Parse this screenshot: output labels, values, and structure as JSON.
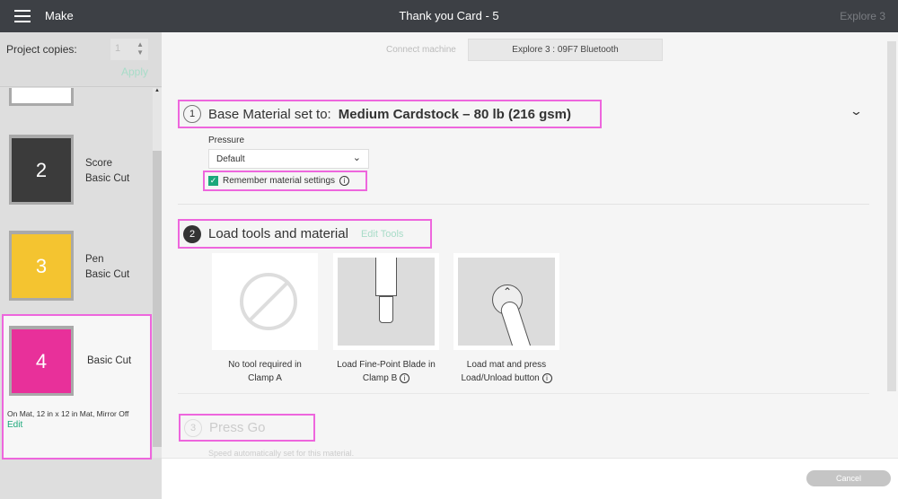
{
  "header": {
    "menu_icon": "hamburger-icon",
    "title": "Make",
    "document": "Thank you Card - 5",
    "machine": "Explore 3"
  },
  "sidebar": {
    "copies_label": "Project copies:",
    "copies_value": "1",
    "apply": "Apply",
    "mats": [
      {
        "number": "2",
        "line1": "Score",
        "line2": "Basic Cut",
        "color": "#3b3b3b"
      },
      {
        "number": "3",
        "line1": "Pen",
        "line2": "Basic Cut",
        "color": "#f4c430"
      },
      {
        "number": "4",
        "line1": "Basic Cut",
        "line2": "",
        "color": "#e8309a"
      }
    ],
    "selected_details": "On Mat, 12 in x 12 in Mat, Mirror Off",
    "edit": "Edit"
  },
  "connect": {
    "label": "Connect machine",
    "device": "Explore 3 : 09F7 Bluetooth"
  },
  "step1": {
    "number": "1",
    "label": "Base Material set to:",
    "material": "Medium Cardstock – 80 lb (216 gsm)",
    "pressure_label": "Pressure",
    "pressure_value": "Default",
    "remember": "Remember material settings",
    "remember_checked": true
  },
  "step2": {
    "number": "2",
    "label": "Load tools and material",
    "edit_tools": "Edit Tools",
    "cards": [
      {
        "line1": "No tool required in",
        "line2": "Clamp A"
      },
      {
        "line1": "Load Fine-Point Blade in",
        "line2": "Clamp B"
      },
      {
        "line1": "Load mat and press",
        "line2": "Load/Unload button"
      }
    ]
  },
  "step3": {
    "number": "3",
    "label": "Press Go",
    "note": "Speed automatically set for this material."
  },
  "footer": {
    "cancel": "Cancel"
  },
  "colors": {
    "accent": "#1aa87a",
    "highlight": "#ee66dd",
    "header": "#3d4045"
  }
}
